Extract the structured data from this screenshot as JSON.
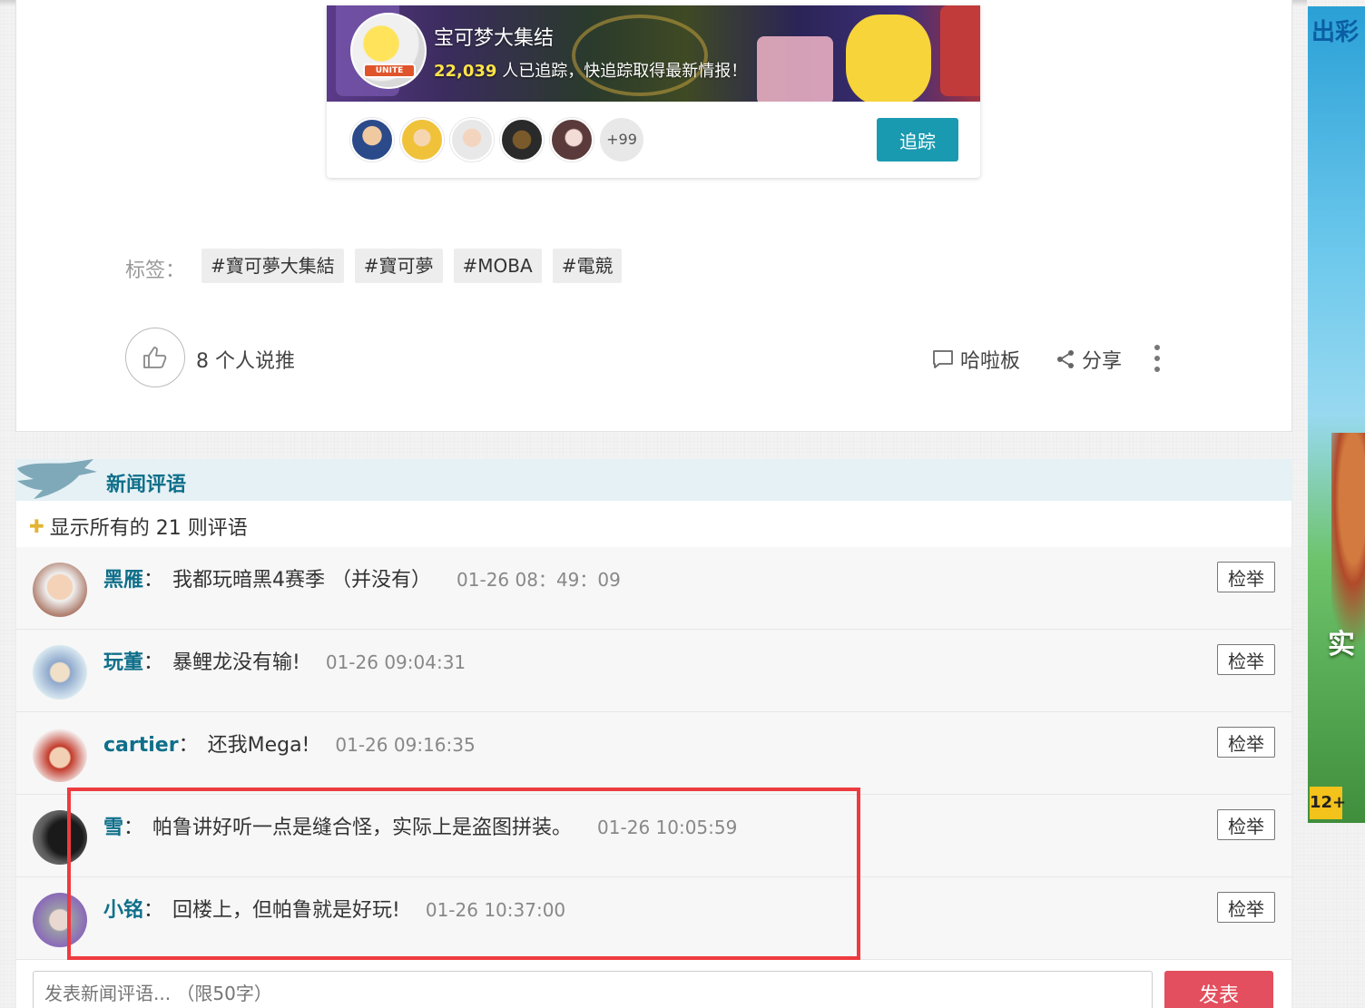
{
  "board": {
    "title": "宝可梦大集结",
    "follower_count": "22,039",
    "follower_suffix": "人已追踪，快追踪取得最新情报！",
    "logo_text": "UNITE",
    "more_followers": "+99",
    "follow_label": "追踪"
  },
  "tags": {
    "label": "标签：",
    "items": [
      "#寶可夢大集結",
      "#寶可夢",
      "#MOBA",
      "#電競"
    ]
  },
  "actions": {
    "like_text": "8 个人说推",
    "board_label": "哈啦板",
    "share_label": "分享"
  },
  "comments": {
    "header": "新闻评语",
    "show_all": "显示所有的 21 则评语",
    "report_label": "检举",
    "items": [
      {
        "user": "黑雁",
        "text": "我都玩暗黑4赛季 （并没有）",
        "time": "01-26 08：49：09",
        "avatar_color": "#e9d6c8"
      },
      {
        "user": "玩董",
        "text": "暴鲤龙没有输!",
        "time": "01-26 09:04:31",
        "avatar_color": "#9bb8d6"
      },
      {
        "user": "cartier",
        "text": "还我Mega!",
        "time": "01-26 09:16:35",
        "avatar_color": "#c23a2a"
      },
      {
        "user": "雪",
        "text": "帕鲁讲好听一点是缝合怪，实际上是盗图拼装。",
        "time": "01-26 10:05:59",
        "avatar_color": "#3a3a3a"
      },
      {
        "user": "小铭",
        "text": "回楼上，但帕鲁就是好玩!",
        "time": "01-26 10:37:00",
        "avatar_color": "#8a7ab8"
      }
    ],
    "input_placeholder": "发表新闻评语... （限50字）",
    "submit_label": "发表"
  },
  "ad": {
    "text_top": "出彩",
    "text_mid": "实",
    "age_rating": "12+"
  },
  "colors": {
    "accent_teal": "#1a9ab0",
    "name_blue": "#0f6f8a",
    "submit_red": "#e34f5e",
    "highlight_red": "#ee3b3f"
  }
}
